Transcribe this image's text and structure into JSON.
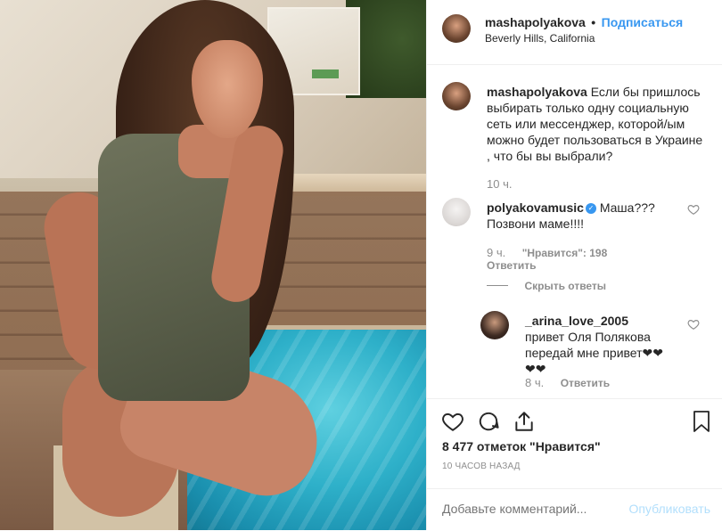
{
  "header": {
    "username": "mashapolyakova",
    "separator": "•",
    "follow_label": "Подписаться",
    "location": "Beverly Hills, California"
  },
  "caption": {
    "username": "mashapolyakova",
    "text": "Если бы пришлось выбирать только одну социальную сеть или мессенджер, которой/ым можно будет пользоваться в Украине , что бы вы выбрали?",
    "time": "10 ч."
  },
  "comments": [
    {
      "username": "polyakovamusic",
      "verified_mark": "✓",
      "text": "Маша??? Позвони маме!!!!",
      "time": "9 ч.",
      "likes": "\"Нравится\": 198",
      "reply_label": "Ответить",
      "hide_replies_label": "Скрыть ответы",
      "replies": [
        {
          "username": "_arina_love_2005",
          "text": "привет Оля Полякова передай мне привет❤❤❤❤",
          "time": "8 ч.",
          "reply_label": "Ответить"
        }
      ]
    }
  ],
  "actions": {
    "like_icon": "heart-icon",
    "comment_icon": "comment-icon",
    "share_icon": "share-icon",
    "save_icon": "bookmark-icon"
  },
  "likes_text": "8 477 отметок \"Нравится\"",
  "time_ago": "10 ЧАСОВ НАЗАД",
  "add_comment": {
    "placeholder": "Добавьте комментарий...",
    "post_label": "Опубликовать"
  },
  "colors": {
    "accent": "#3897f0",
    "muted": "#8e8e8e",
    "post_disabled": "#b2dffc"
  }
}
